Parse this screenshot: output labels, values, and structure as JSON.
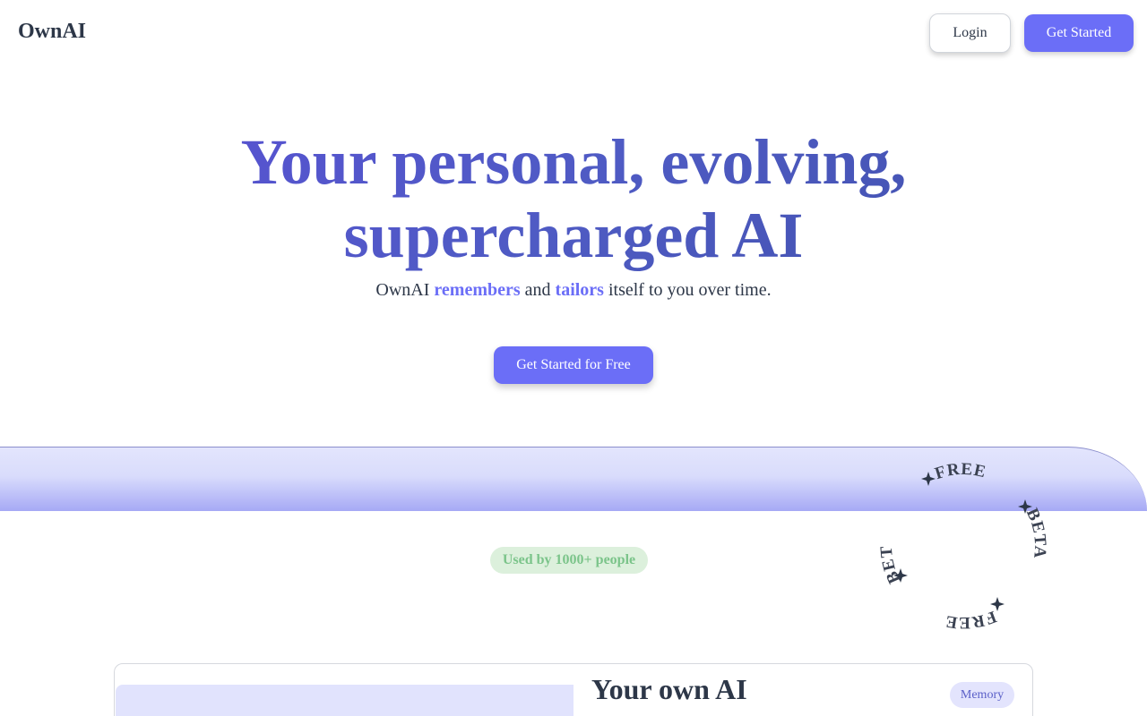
{
  "header": {
    "logo": "OwnAI",
    "login_label": "Login",
    "get_started_label": "Get Started"
  },
  "hero": {
    "title_line1": "Your personal, evolving,",
    "title_line2": "supercharged AI",
    "subtitle_prefix": "OwnAI ",
    "subtitle_accent1": "remembers",
    "subtitle_middle": " and ",
    "subtitle_accent2": "tailors",
    "subtitle_suffix": " itself to you over time.",
    "cta_label": "Get Started for Free"
  },
  "social_proof": {
    "badge": "Used by 1000+ people"
  },
  "stamp": {
    "words": [
      "FREE",
      "BETA",
      "FREE",
      "BETA"
    ],
    "icon": "sparkle-star-icon"
  },
  "feature_card": {
    "title": "Your own AI",
    "badge": "Memory"
  },
  "colors": {
    "accent": "#6b6ef7",
    "heading_gradient_start": "#5a4fd6",
    "heading_gradient_end": "#3e4fa8",
    "badge_green_bg": "#dcf0dc",
    "badge_green_text": "#7bc48a",
    "band_light": "#e3e5fd",
    "band_dark": "#a6a9f5"
  }
}
